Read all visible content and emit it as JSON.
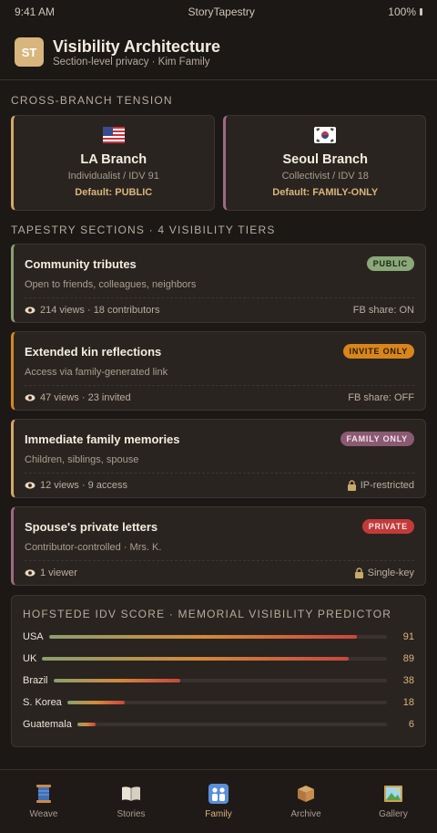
{
  "status": {
    "time": "9:41 AM",
    "app": "StoryTapestry",
    "battery": "100%"
  },
  "header": {
    "logo": "ST",
    "title": "Visibility Architecture",
    "subtitle": "Section-level privacy · Kim Family"
  },
  "tension": {
    "label": "CROSS-BRANCH TENSION",
    "branches": [
      {
        "name": "LA Branch",
        "flag_icon": "us-flag-icon",
        "type": "Individualist / IDV 91",
        "default": "Default: PUBLIC",
        "accent": "#d4a86a"
      },
      {
        "name": "Seoul Branch",
        "flag_icon": "kr-flag-icon",
        "type": "Collectivist / IDV 18",
        "default": "Default: FAMILY-ONLY",
        "accent": "#9c6a84"
      }
    ]
  },
  "tiers": {
    "label": "TAPESTRY SECTIONS · 4 VISIBILITY TIERS",
    "items": [
      {
        "title": "Community tributes",
        "sub": "Open to friends, colleagues, neighbors",
        "badge": "PUBLIC",
        "stats": "214 views · 18 contributors",
        "right": "FB share: ON",
        "accent": "#8aa06e",
        "badge_bg": "#8aa878",
        "badge_fg": "#20281a",
        "right_icon": ""
      },
      {
        "title": "Extended kin reflections",
        "sub": "Access via family-generated link",
        "badge": "INVITE ONLY",
        "stats": "47 views · 23 invited",
        "right": "FB share: OFF",
        "accent": "#d4881e",
        "badge_bg": "#d8861c",
        "badge_fg": "#2a1a08",
        "right_icon": ""
      },
      {
        "title": "Immediate family memories",
        "sub": "Children, siblings, spouse",
        "badge": "FAMILY ONLY",
        "stats": "12 views · 9 access",
        "right": "IP-restricted",
        "accent": "#d4a86a",
        "badge_bg": "#8a5a73",
        "badge_fg": "#f3e2ea",
        "right_icon": "lock-icon"
      },
      {
        "title": "Spouse's private letters",
        "sub": "Contributor-controlled · Mrs. K.",
        "badge": "PRIVATE",
        "stats": "1 viewer",
        "right": "Single-key",
        "accent": "#9c6a84",
        "badge_bg": "#c23a3a",
        "badge_fg": "#fbe6e6",
        "right_icon": "lock-icon"
      }
    ]
  },
  "idv": {
    "title": "HOFSTEDE IDV SCORE · MEMORIAL VISIBILITY PREDICTOR",
    "rows": [
      {
        "country": "USA",
        "value": 91
      },
      {
        "country": "UK",
        "value": 89
      },
      {
        "country": "Brazil",
        "value": 38
      },
      {
        "country": "S. Korea",
        "value": 18
      },
      {
        "country": "Guatemala",
        "value": 6
      }
    ]
  },
  "nav": [
    {
      "label": "Weave",
      "icon": "spool-icon",
      "active": false
    },
    {
      "label": "Stories",
      "icon": "book-icon",
      "active": false
    },
    {
      "label": "Family",
      "icon": "family-icon",
      "active": true
    },
    {
      "label": "Archive",
      "icon": "box-icon",
      "active": false
    },
    {
      "label": "Gallery",
      "icon": "picture-icon",
      "active": false
    }
  ],
  "colors": {
    "background": "#1c1816",
    "card": "#2a2420",
    "gold": "#d8b57c"
  }
}
